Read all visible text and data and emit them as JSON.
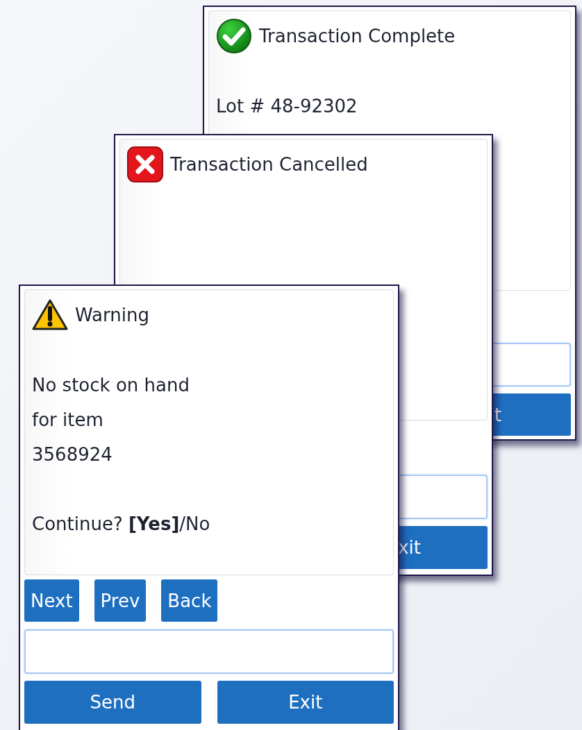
{
  "windows": [
    {
      "kind": "success",
      "title": "Transaction Complete",
      "message_paragraphs": [
        [
          "Lot # 48-92302"
        ]
      ],
      "exit_button": "t"
    },
    {
      "kind": "error",
      "title": "Transaction Cancelled",
      "exit_button": "xit"
    },
    {
      "kind": "warning",
      "title": "Warning",
      "message_paragraphs": [
        [
          "No stock on hand",
          "for item",
          "3568924"
        ],
        [
          "Continue? **[Yes]**/No"
        ]
      ],
      "nav_buttons": [
        "Next",
        "Prev",
        "Back"
      ],
      "send_button": "Send",
      "exit_button": "Exit"
    }
  ]
}
